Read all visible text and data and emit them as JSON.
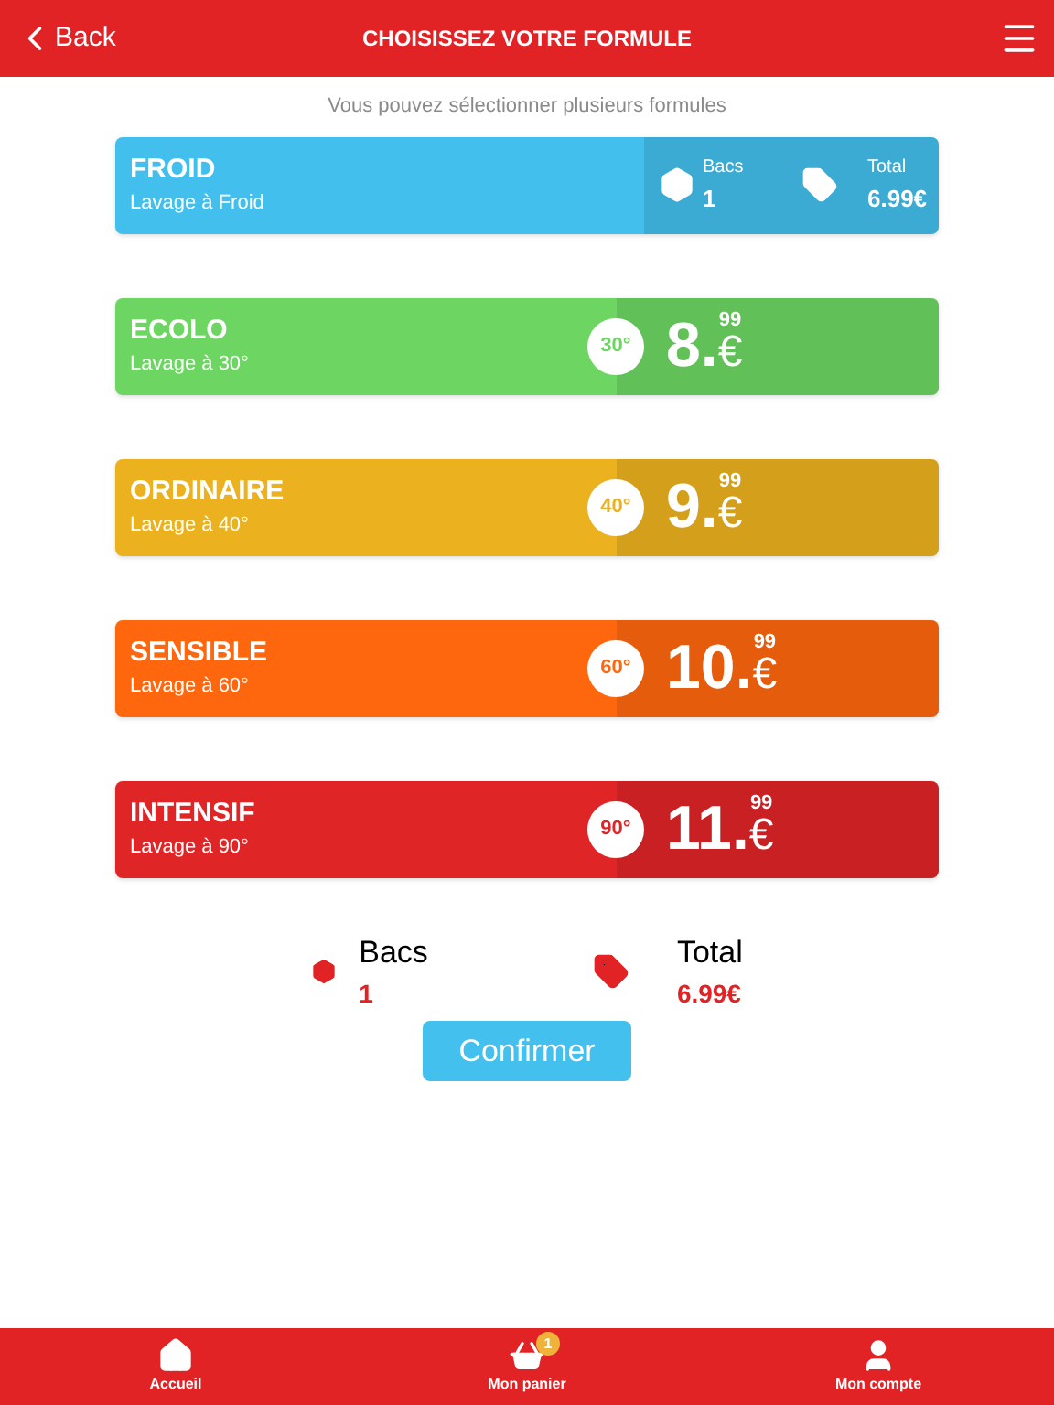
{
  "header": {
    "back": "Back",
    "title": "CHOISISSEZ VOTRE FORMULE"
  },
  "subtitle": "Vous pouvez sélectionner plusieurs formules",
  "formulas": [
    {
      "name": "FROID",
      "description": "Lavage à Froid",
      "selected": true,
      "color": "#42bfed",
      "bacs_label": "Bacs",
      "bacs": "1",
      "total_label": "Total",
      "total": "6.99€"
    },
    {
      "name": "ECOLO",
      "description": "Lavage à 30°",
      "selected": false,
      "color": "#6dd663",
      "temperature": "30°",
      "price": "8.",
      "cents": "99",
      "currency": "€"
    },
    {
      "name": "ORDINAIRE",
      "description": "Lavage à 40°",
      "selected": false,
      "color": "#ecb11e",
      "temperature": "40°",
      "price": "9.",
      "cents": "99",
      "currency": "€"
    },
    {
      "name": "SENSIBLE",
      "description": "Lavage à 60°",
      "selected": false,
      "color": "#fe670e",
      "temperature": "60°",
      "price": "10.",
      "cents": "99",
      "currency": "€"
    },
    {
      "name": "INTENSIF",
      "description": "Lavage à 90°",
      "selected": false,
      "color": "#e02527",
      "temperature": "90°",
      "price": "11.",
      "cents": "99",
      "currency": "€"
    }
  ],
  "summary": {
    "bacs_label": "Bacs",
    "bacs": "1",
    "total_label": "Total",
    "total": "6.99€"
  },
  "confirm": "Confirmer",
  "nav": [
    {
      "label": "Accueil"
    },
    {
      "label": "Mon panier",
      "badge": "1"
    },
    {
      "label": "Mon compte"
    }
  ]
}
